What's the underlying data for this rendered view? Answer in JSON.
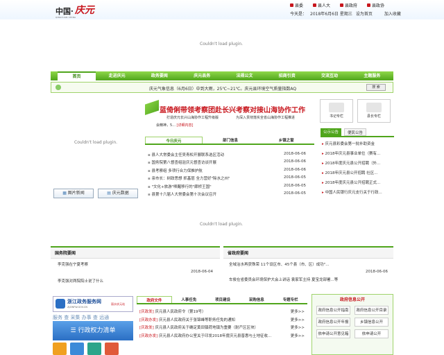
{
  "header": {
    "logo_cn": "中国·",
    "logo_red": "庆元",
    "logo_sub": "QINGYUAN CHINA",
    "links": [
      "县委",
      "县人大",
      "县政府",
      "县政协"
    ],
    "today_label": "今天是：",
    "date": "2018年6月6日 星期三",
    "set_home": "设为首页",
    "add_fav": "加入收藏"
  },
  "plugin_msg": "Couldn't load plugin.",
  "nav": {
    "items": [
      "首页",
      "走进庆元",
      "政务要闻",
      "庆元县务",
      "法规公文",
      "招商引资",
      "交流互动",
      "主题服务"
    ]
  },
  "ticker": "庆元气象信息（6月6日）中到大雨，25℃~21℃。庆元县环境空气质量指数AQ",
  "search_label": "搜 索",
  "headline": {
    "title": "蓝倚俐带领考察团赴长兴考察对接山海协作工作",
    "lead1": "打造庆元长兴山海协作工程升级版",
    "lead2": "为深入贯彻落实全省山海协作工程推进",
    "lead3": "会精神，5...",
    "detail_link": "[详细内容]"
  },
  "news_tabs": [
    "今日庆元",
    "部门信息",
    "乡镇之窗"
  ],
  "news": [
    {
      "title": "县人大常委会主任吴青松开展联系选区活动",
      "date": "2018-06-06"
    },
    {
      "title": "国务院第八督查组驻庆元督查访谈开展",
      "date": "2018-06-06"
    },
    {
      "title": "县考察组 多项行合力保推护航",
      "date": "2018-06-06"
    },
    {
      "title": "亲市长：树政思想 抓基层 全力营好\"除水之州\"",
      "date": "2018-06-05"
    },
    {
      "title": "\"文化+旅游\"唤醒移行的\"廊桥王国\"",
      "date": "2018-06-05"
    },
    {
      "title": "县第十六届人大常委会第十次会议召开",
      "date": "2018-06-05"
    }
  ],
  "side_icons": [
    "书记专栏",
    "县长专栏"
  ],
  "right_tabs": [
    "公示公告",
    "便民公告"
  ],
  "right_list": [
    "庆元县彩委会第一批补助资金",
    "2018年庆元县事业单位（赛有...",
    "2018年度庆元县公开招聘（外...",
    "2018年庆元县公开招聘 社区...",
    "2018年度庆元县公开招聘正式...",
    "中国人民银行庆元支行关于行政..."
  ],
  "pic_buttons": [
    "图片新闻",
    "庆元数据"
  ],
  "guowuyuan": {
    "title": "国务院要闻",
    "items": [
      "李克强在宁夏考察",
      "李克强对两院院士说了什么"
    ],
    "date": "2018-06-04"
  },
  "shengzhengfu": {
    "title": "省政府要闻",
    "items": [
      "全域治水再获殊荣 11个设区市、45个县（市、区）成功\"...",
      "车俊在省委员会环境保护大会上讲话 袁家军主持 夏宝龙部署...等"
    ],
    "date": "2018-06-06"
  },
  "zwfw": {
    "title": "浙江政务服务网",
    "sub": "ZJZWFW.GOV.CN",
    "tag": "丽水庆元站",
    "quick": "服务 查 采集 办事 查 远通",
    "list_btn": "行政权力清单"
  },
  "gk_tabs": [
    "政府文件",
    "人事任免",
    "项目建设",
    "采购信息",
    "专题专栏"
  ],
  "gk": [
    {
      "tag": "[庆政发]",
      "title": "庆元县人民政府令（第19号）",
      "more": "更多>>"
    },
    {
      "tag": "[庆政办发]",
      "title": "庆元县人民政府关于张锦峰等职务任免的通知",
      "more": "更多>>"
    },
    {
      "tag": "[庆政发]",
      "title": "庆元县人民政府关于确定黄田镇荷地镇为重要（耐产区区块）",
      "more": "更多>>"
    },
    {
      "tag": "[庆政办发]",
      "title": "庆元县人民政府办公室关于印发2018年度庆元县普惠与土地征收...",
      "more": "更多>>"
    }
  ],
  "info_panel": {
    "title": "政府信息公开",
    "buttons": [
      "政府信息公开指南",
      "政府信息公开目录",
      "政府信息公开年报",
      "乡镇信息公开",
      "依申请公开意见箱",
      "依申请公开"
    ]
  },
  "colors": {
    "green": "#4fa51b",
    "red": "#c8161d",
    "blue": "#2b6fc4"
  }
}
